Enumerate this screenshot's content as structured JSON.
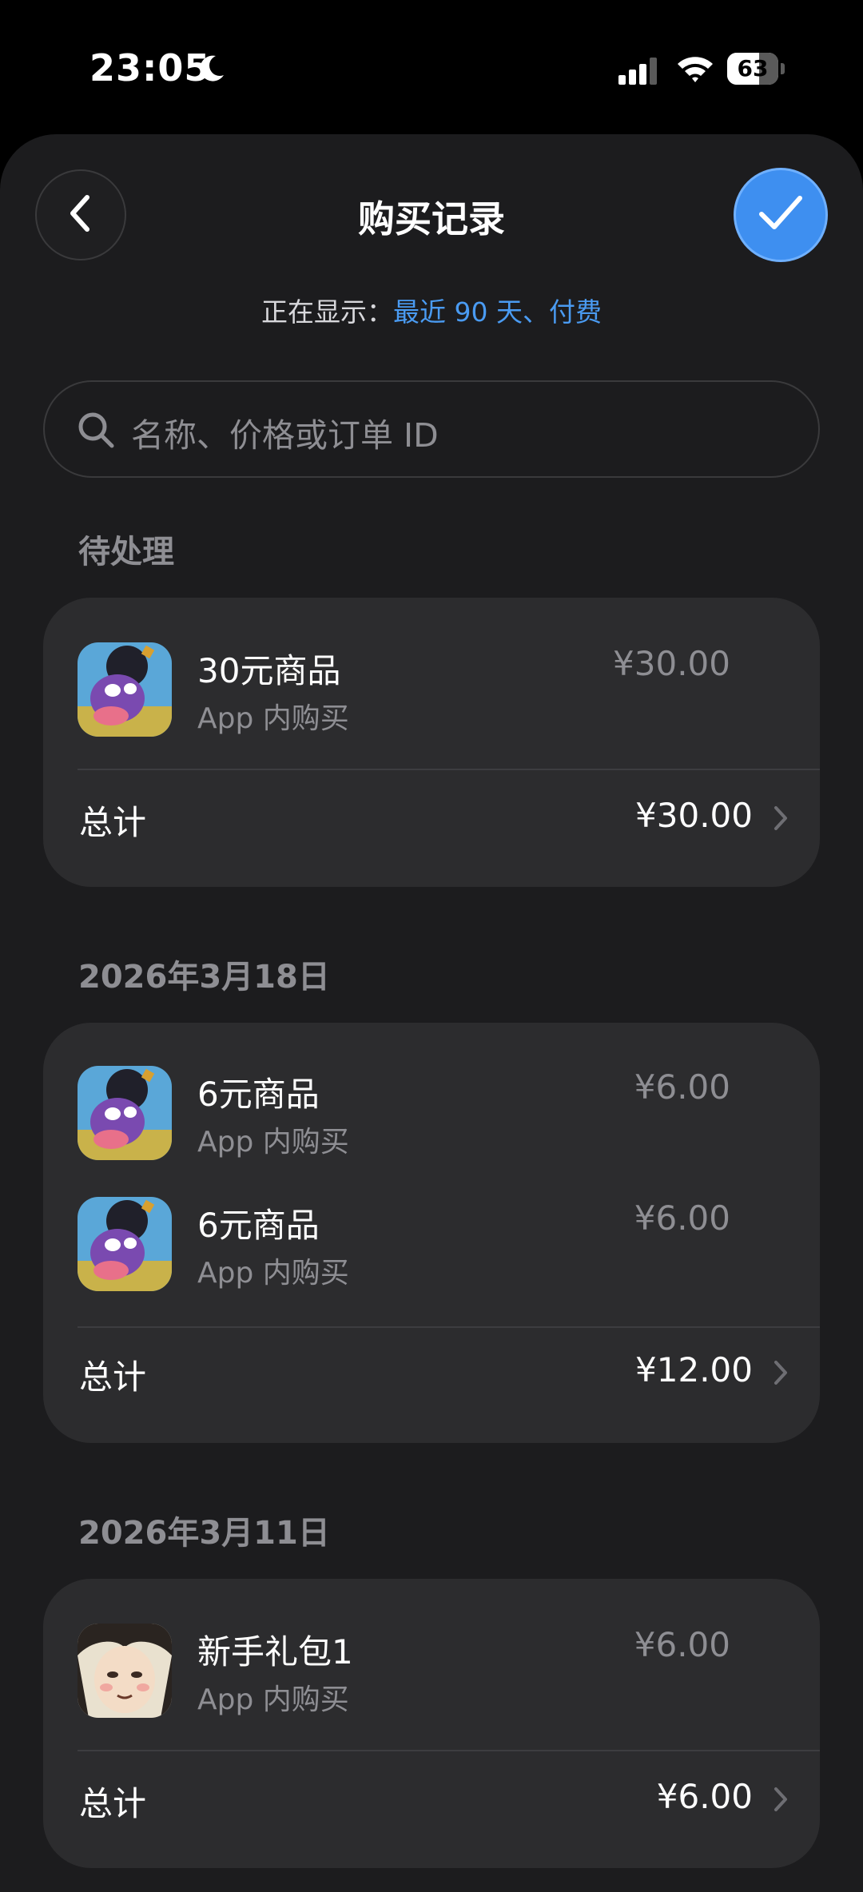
{
  "status_bar": {
    "time": "23:05",
    "battery": "63",
    "battery_level": 0.63
  },
  "nav": {
    "title": "购买记录",
    "back_icon": "chevron-left-icon",
    "done_icon": "checkmark-icon"
  },
  "filter": {
    "label": "正在显示：",
    "value": "最近 90 天、付费"
  },
  "search": {
    "placeholder": "名称、价格或订单 ID"
  },
  "sections": [
    {
      "header": "待处理",
      "items": [
        {
          "name": "30元商品",
          "subtitle": "App 内购买",
          "price": "¥30.00",
          "icon": "bomb-game-app-icon"
        }
      ],
      "total_label": "总计",
      "total": "¥30.00"
    },
    {
      "header": "2026年3月18日",
      "items": [
        {
          "name": "6元商品",
          "subtitle": "App 内购买",
          "price": "¥6.00",
          "icon": "bomb-game-app-icon"
        },
        {
          "name": "6元商品",
          "subtitle": "App 内购买",
          "price": "¥6.00",
          "icon": "bomb-game-app-icon"
        }
      ],
      "total_label": "总计",
      "total": "¥12.00"
    },
    {
      "header": "2026年3月11日",
      "items": [
        {
          "name": "新手礼包1",
          "subtitle": "App 内购买",
          "price": "¥6.00",
          "icon": "character-game-app-icon"
        }
      ],
      "total_label": "总计",
      "total": "¥6.00"
    }
  ],
  "colors": {
    "accent": "#3e8ff0",
    "link": "#4a9bf2",
    "card": "#2c2c2e",
    "sheet": "#1c1c1e"
  }
}
